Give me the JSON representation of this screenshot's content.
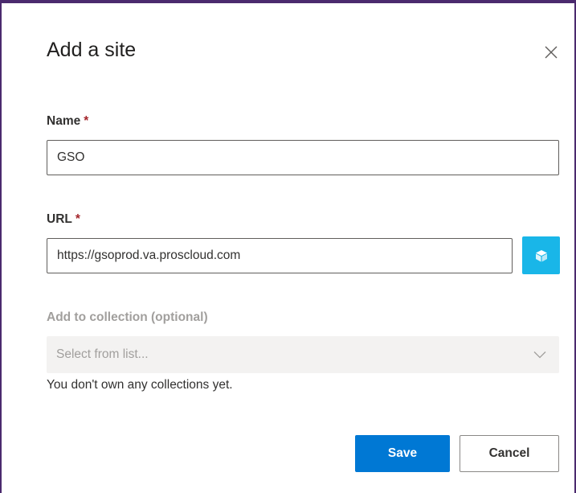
{
  "dialog": {
    "title": "Add a site",
    "close_icon": "close-icon"
  },
  "fields": {
    "name": {
      "label": "Name",
      "required_marker": "*",
      "value": "GSO"
    },
    "url": {
      "label": "URL",
      "required_marker": "*",
      "value": "https://gsoprod.va.proscloud.com",
      "action_icon": "cube-icon"
    },
    "collection": {
      "label": "Add to collection (optional)",
      "placeholder": "Select from list...",
      "dropdown_icon": "chevron-down-icon",
      "note": "You don't own any collections yet."
    }
  },
  "buttons": {
    "save_label": "Save",
    "cancel_label": "Cancel"
  },
  "colors": {
    "frame_border": "#4b2a6e",
    "primary": "#0078d4",
    "icon_button": "#19b6e8",
    "required": "#a4262c"
  }
}
